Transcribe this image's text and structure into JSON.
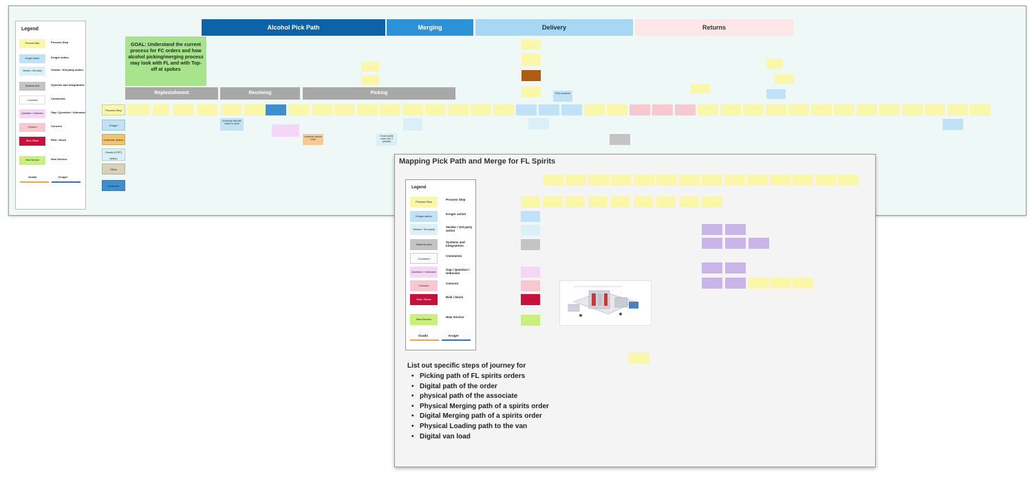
{
  "legend": {
    "title": "Legend",
    "items": [
      {
        "swatch": "Process Step",
        "label": "Process Step",
        "color": "#fbf7a9"
      },
      {
        "swatch": "Kroger action",
        "label": "Kroger action",
        "color": "#bfe2f6"
      },
      {
        "swatch": "Vendor / 3rd party action",
        "label": "Vendor / 3rd party action",
        "color": "#d9f1f6"
      },
      {
        "swatch": "Systems and Integrations",
        "label": "Systems and Integrations",
        "color": "#c4c4c4"
      },
      {
        "swatch": "Comment",
        "label": "Comments",
        "color": "#ffffff"
      },
      {
        "swatch": "Question / Unknown",
        "label": "Gap / Question / Unknown",
        "color": "#f6d6f6"
      },
      {
        "swatch": "Concern",
        "label": "Concern",
        "color": "#f8c8d0"
      },
      {
        "swatch": "Risk / Block",
        "label": "Risk / block",
        "color": "#c7103c"
      },
      {
        "swatch": "New Service",
        "label": "New Service",
        "color": "#c8f07a"
      }
    ],
    "ocado": "Ocado",
    "kroger": "Kroger"
  },
  "banners": [
    {
      "label": "Alcohol Pick Path",
      "bg": "#0d63a8",
      "fg": "#ffffff"
    },
    {
      "label": "Merging",
      "bg": "#2b92d8",
      "fg": "#ffffff"
    },
    {
      "label": "Delivery",
      "bg": "#a6d8f4",
      "fg": "#1b2b3a"
    },
    {
      "label": "Returns",
      "bg": "#fce6e8",
      "fg": "#333333"
    }
  ],
  "goal": "GOAL: Understand the current process for FC orders and how alcohol picking/merging process may look with FL and with Top-off at spokes",
  "phases": [
    "Replenishment",
    "Receiving",
    "Picking"
  ],
  "lanes": [
    "Process Step",
    "Kroger",
    "Customer Action",
    "Ocado (OSP) Action",
    "Other",
    "Customer"
  ],
  "board_notes": [
    "Inventory allocate online to store",
    "customer places order",
    "Ocado splits order into 2 picklists",
    "Pick complete"
  ],
  "panel": {
    "title": "Mapping Pick Path and Merge for FL Spirits",
    "list_title": "List out specific steps of journey for",
    "list": [
      "Picking path of FL spirits orders",
      "Digital path of the order",
      "physical path of the associate",
      "Physical Merging path of a spirits order",
      "Digital Merging path of a spirits order",
      "Physical Loading path to the van",
      "Digital van load"
    ]
  }
}
